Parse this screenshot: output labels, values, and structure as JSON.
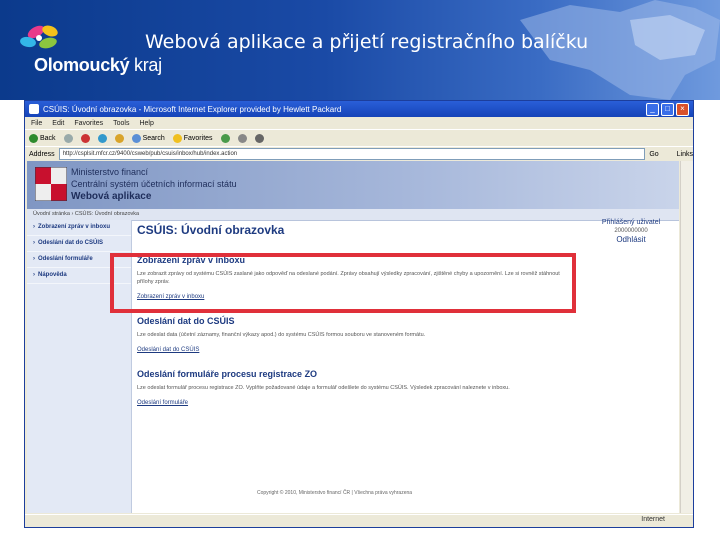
{
  "slide": {
    "title": "Webová aplikace a přijetí registračního balíčku",
    "logo_text_bold": "Olomoucký",
    "logo_text_light": "kraj"
  },
  "browser": {
    "window_title": "CSÚIS: Úvodní obrazovka - Microsoft Internet Explorer provided by Hewlett Packard",
    "menu": [
      "File",
      "Edit",
      "Favorites",
      "Tools",
      "Help"
    ],
    "toolbar": {
      "back": "Back",
      "search": "Search",
      "favorites": "Favorites"
    },
    "address_label": "Address",
    "address_value": "http://csplsit.mfcr.cz/9400/csweb/pub/csuis/inbox/hub/index.action",
    "go_label": "Go",
    "links_label": "Links",
    "status_zone": "Internet"
  },
  "page": {
    "ministry": "Ministerstvo financí",
    "system": "Centrální systém účetních informací státu",
    "app": "Webová aplikace",
    "breadcrumb": "Úvodní stránka › CSÚIS: Úvodní obrazovka",
    "nav": [
      "Zobrazení zpráv v inboxu",
      "Odeslání dat do CSÚIS",
      "Odeslání formuláře",
      "Nápověda"
    ],
    "heading": "CSÚIS: Úvodní obrazovka",
    "user": {
      "label": "Přihlášený uživatel",
      "id": "2000000000",
      "logout": "Odhlásit"
    },
    "sections": [
      {
        "title": "Zobrazení zpráv v inboxu",
        "text": "Lze zobrazit zprávy od systému CSÚIS zaslané jako odpověď na odeslané podání. Zprávy obsahují výsledky zpracování, zjištěné chyby a upozornění. Lze si rovněž stáhnout přílohy zpráv.",
        "link": "Zobrazení zpráv v inboxu"
      },
      {
        "title": "Odeslání dat do CSÚIS",
        "text": "Lze odeslat data (účetní záznamy, finanční výkazy apod.) do systému CSÚIS formou souboru ve stanoveném formátu.",
        "link": "Odeslání dat do CSÚIS"
      },
      {
        "title": "Odeslání formuláře procesu registrace ZO",
        "text": "Lze odeslat formulář procesu registrace ZO. Vyplňte požadované údaje a formulář odešlete do systému CSÚIS. Výsledek zpracování naleznete v inboxu.",
        "link": "Odeslání formuláře"
      }
    ],
    "footer": "Copyright © 2010, Ministerstvo financí ČR | Všechna práva vyhrazena"
  },
  "colors": {
    "highlight": "#e0303a",
    "nav_text": "#1d3a80",
    "banner": "#a7b8db"
  }
}
